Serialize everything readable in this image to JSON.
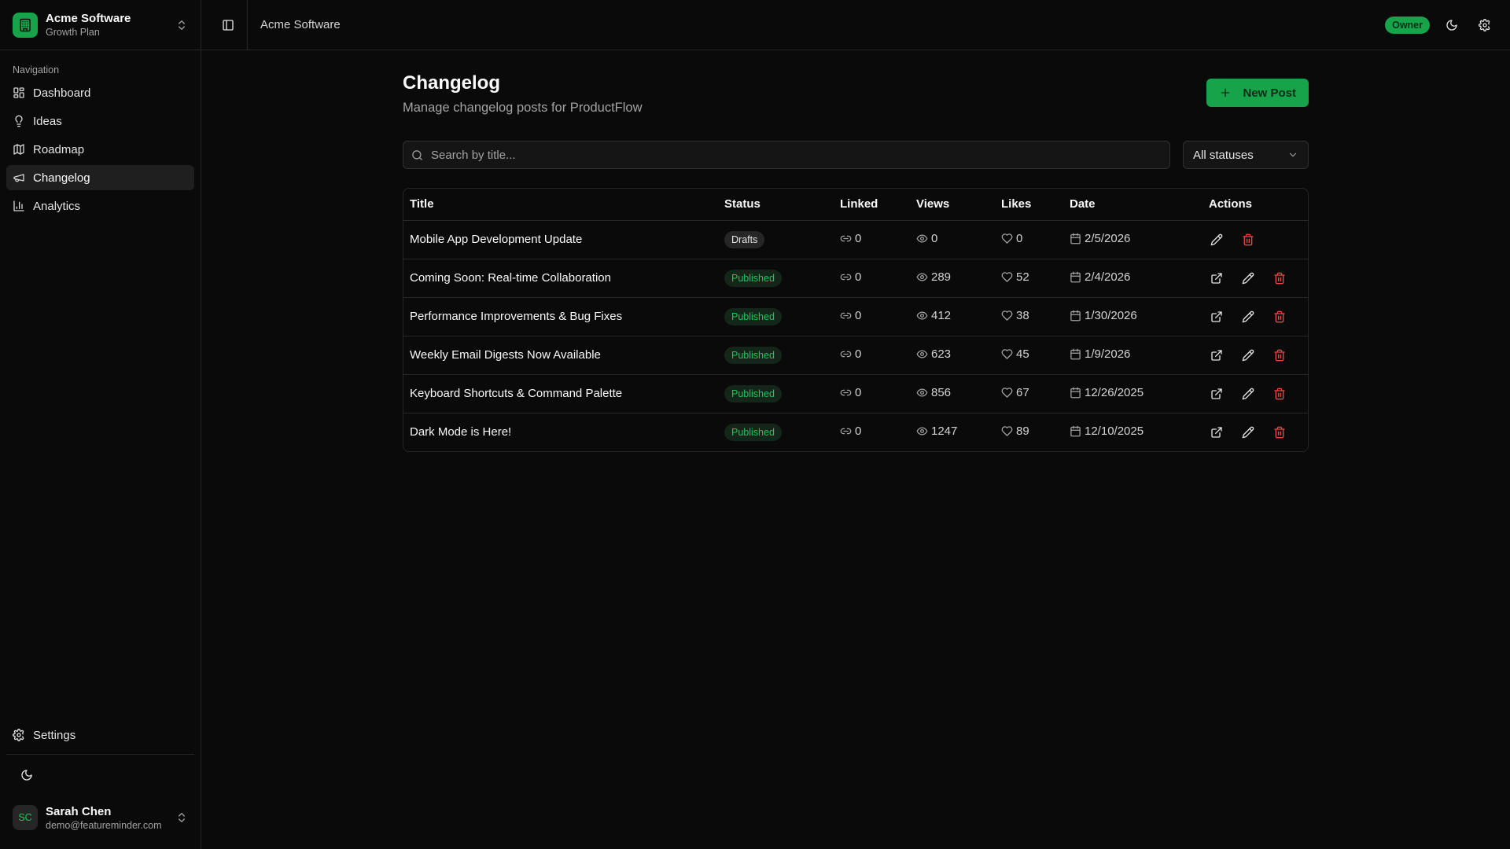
{
  "org": {
    "name": "Acme Software",
    "plan": "Growth Plan"
  },
  "sidebar": {
    "nav_label": "Navigation",
    "items": [
      {
        "label": "Dashboard",
        "icon": "dashboard-icon"
      },
      {
        "label": "Ideas",
        "icon": "lightbulb-icon"
      },
      {
        "label": "Roadmap",
        "icon": "map-icon"
      },
      {
        "label": "Changelog",
        "icon": "megaphone-icon",
        "active": true
      },
      {
        "label": "Analytics",
        "icon": "bar-chart-icon"
      }
    ],
    "settings_label": "Settings"
  },
  "user": {
    "initials": "SC",
    "name": "Sarah Chen",
    "email": "demo@featureminder.com"
  },
  "topbar": {
    "breadcrumb": "Acme Software",
    "role_badge": "Owner"
  },
  "page": {
    "title": "Changelog",
    "subtitle": "Manage changelog posts for ProductFlow",
    "new_post_label": "New Post",
    "search_placeholder": "Search by title...",
    "status_filter": "All statuses"
  },
  "table": {
    "headers": [
      "Title",
      "Status",
      "Linked",
      "Views",
      "Likes",
      "Date",
      "Actions"
    ],
    "rows": [
      {
        "title": "Mobile App Development Update",
        "status": "Drafts",
        "linked": "0",
        "views": "0",
        "likes": "0",
        "date": "2/5/2026"
      },
      {
        "title": "Coming Soon: Real-time Collaboration",
        "status": "Published",
        "linked": "0",
        "views": "289",
        "likes": "52",
        "date": "2/4/2026"
      },
      {
        "title": "Performance Improvements & Bug Fixes",
        "status": "Published",
        "linked": "0",
        "views": "412",
        "likes": "38",
        "date": "1/30/2026"
      },
      {
        "title": "Weekly Email Digests Now Available",
        "status": "Published",
        "linked": "0",
        "views": "623",
        "likes": "45",
        "date": "1/9/2026"
      },
      {
        "title": "Keyboard Shortcuts & Command Palette",
        "status": "Published",
        "linked": "0",
        "views": "856",
        "likes": "67",
        "date": "12/26/2025"
      },
      {
        "title": "Dark Mode is Here!",
        "status": "Published",
        "linked": "0",
        "views": "1247",
        "likes": "89",
        "date": "12/10/2025"
      }
    ]
  },
  "colors": {
    "accent": "#16a34a",
    "published_text": "#22c55e",
    "danger": "#ef4444",
    "background": "#0a0a0a"
  }
}
